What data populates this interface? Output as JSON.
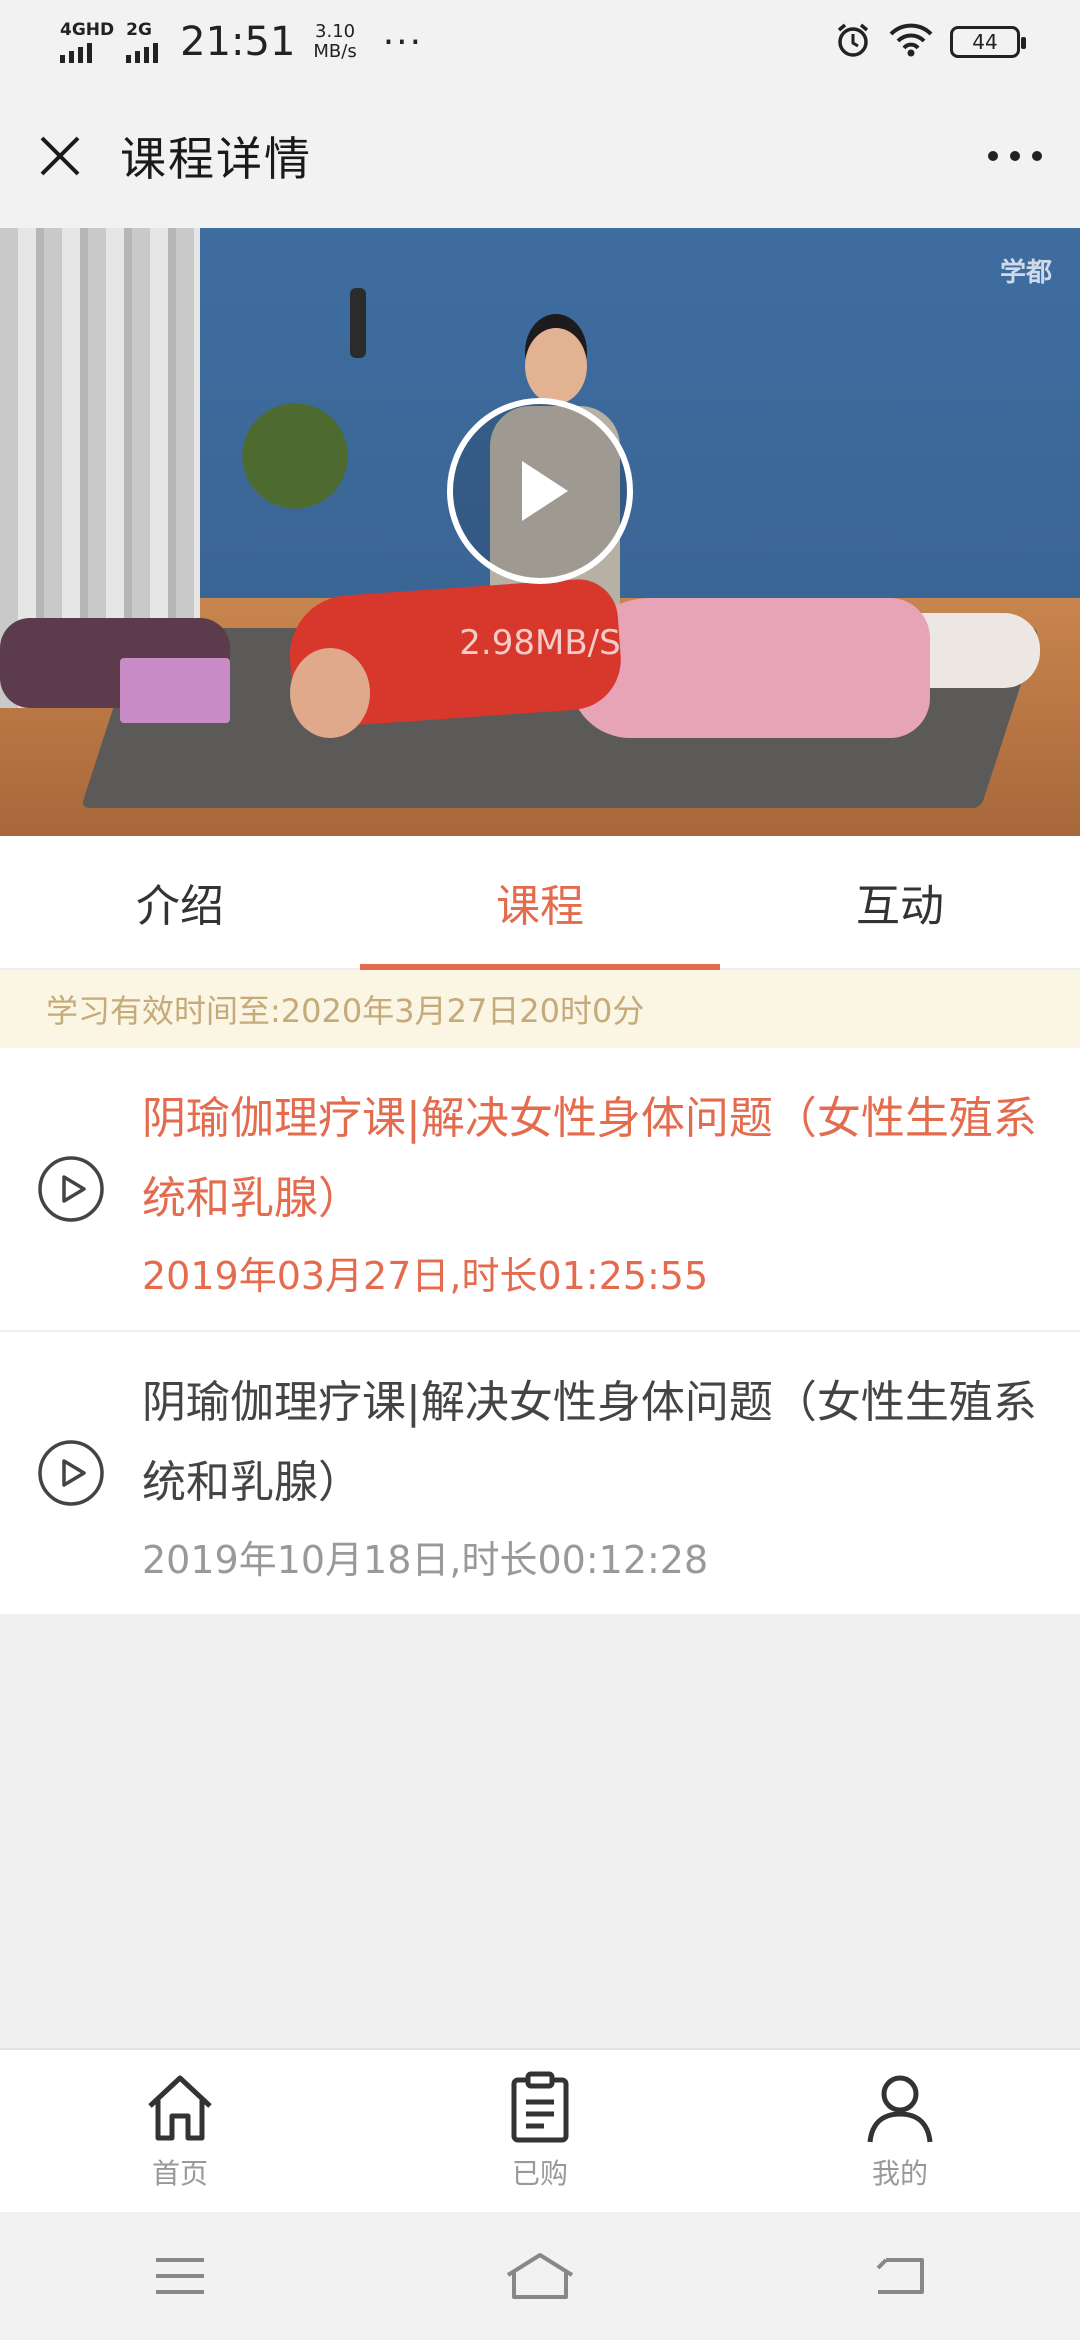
{
  "status_bar": {
    "network1": "4GHD",
    "network2": "2G",
    "time": "21:51",
    "speed_value": "3.10",
    "speed_unit": "MB/s",
    "more": "···",
    "battery": "44",
    "icons": [
      "alarm-icon",
      "wifi-icon",
      "battery-icon"
    ]
  },
  "header": {
    "title": "课程详情",
    "close_icon": "close-icon",
    "more_icon": "more-icon"
  },
  "video": {
    "watermark": "学都",
    "speed_text": "2.98MB/S",
    "play_icon": "play-icon"
  },
  "tabs": [
    {
      "label": "介绍",
      "active": false
    },
    {
      "label": "课程",
      "active": true
    },
    {
      "label": "互动",
      "active": false
    }
  ],
  "validity": {
    "text": "学习有效时间至:2020年3月27日20时0分"
  },
  "courses": [
    {
      "title": "阴瑜伽理疗课|解决女性身体问题（女性生殖系统和乳腺）",
      "meta": "2019年03月27日,时长01:25:55",
      "active": true
    },
    {
      "title": "阴瑜伽理疗课|解决女性身体问题（女性生殖系统和乳腺）",
      "meta": "2019年10月18日,时长00:12:28",
      "active": false
    }
  ],
  "bottom_nav": [
    {
      "label": "首页",
      "icon": "home-icon"
    },
    {
      "label": "已购",
      "icon": "clipboard-icon"
    },
    {
      "label": "我的",
      "icon": "user-icon"
    }
  ],
  "colors": {
    "accent": "#e46b4d",
    "validity_bg": "#fbf5e3",
    "validity_text": "#c5aa7a",
    "page_bg": "#f0f0f0"
  }
}
